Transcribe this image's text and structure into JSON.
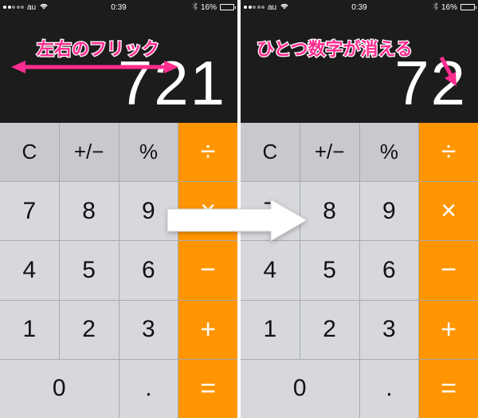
{
  "status": {
    "carrier": "au",
    "time": "0:39",
    "battery_pct": "16%"
  },
  "left": {
    "annotation": "左右のフリック",
    "display": "721"
  },
  "right": {
    "annotation": "ひとつ数字が消える",
    "display": "72"
  },
  "keys": {
    "clear": "C",
    "sign": "+/−",
    "percent": "%",
    "divide": "÷",
    "k7": "7",
    "k8": "8",
    "k9": "9",
    "multiply": "×",
    "k4": "4",
    "k5": "5",
    "k6": "6",
    "minus": "−",
    "k1": "1",
    "k2": "2",
    "k3": "3",
    "plus": "+",
    "k0": "0",
    "decimal": ".",
    "equals": "="
  },
  "colors": {
    "operator": "#ff9500",
    "annotation": "#ff2d8f"
  }
}
